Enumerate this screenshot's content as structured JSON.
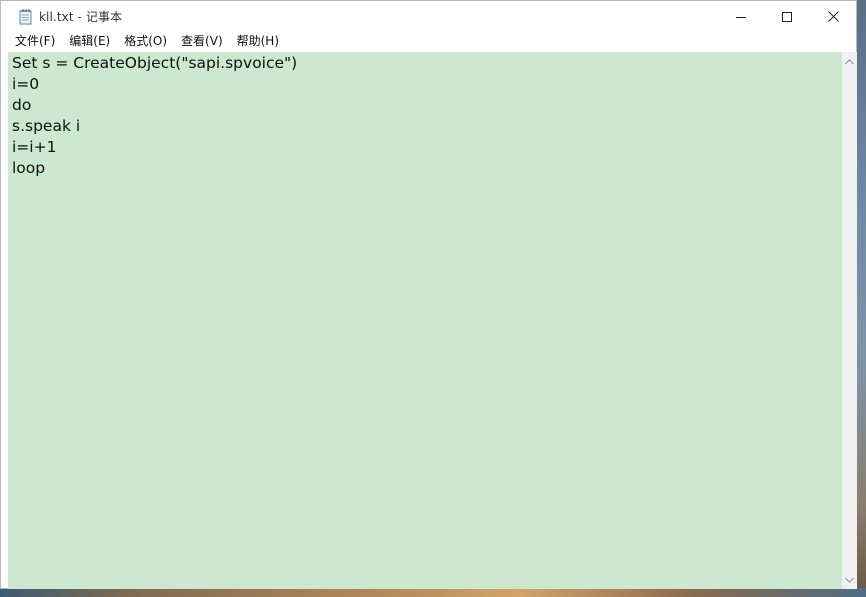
{
  "window": {
    "title": "kll.txt - 记事本"
  },
  "menu": {
    "items": [
      "文件(F)",
      "编辑(E)",
      "格式(O)",
      "查看(V)",
      "帮助(H)"
    ]
  },
  "editor": {
    "lines": [
      "Set s = CreateObject(\"sapi.spvoice\")",
      "i=0",
      "do",
      "s.speak i",
      "i=i+1",
      "loop"
    ]
  },
  "colors": {
    "editor_background": "#cce8cf",
    "window_background": "#ffffff",
    "scrollbar_track": "#f0f0f0"
  },
  "icons": {
    "app": "notepad-icon",
    "minimize": "minimize-icon",
    "maximize": "maximize-icon",
    "close": "close-icon",
    "scroll_up": "scroll-up-arrow-icon",
    "scroll_down": "scroll-down-arrow-icon"
  }
}
